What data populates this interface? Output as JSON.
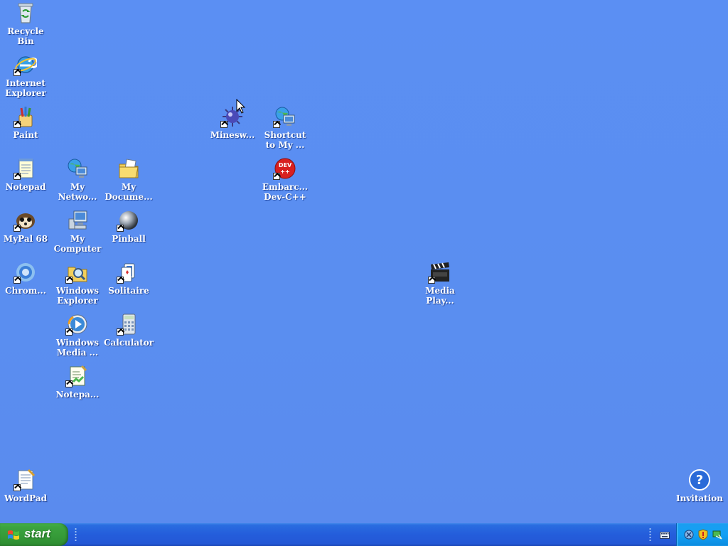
{
  "desktop": {
    "icons": [
      {
        "id": "recycle-bin",
        "label": "Recycle\nBin",
        "shortcut": false
      },
      {
        "id": "internet-explorer",
        "label": "Internet\nExplorer",
        "shortcut": true
      },
      {
        "id": "paint",
        "label": "Paint",
        "shortcut": true
      },
      {
        "id": "notepad",
        "label": "Notepad",
        "shortcut": true
      },
      {
        "id": "mypal",
        "label": "MyPal 68",
        "shortcut": true
      },
      {
        "id": "chrome",
        "label": "Chrom...",
        "shortcut": true
      },
      {
        "id": "my-network",
        "label": "My\nNetwo...",
        "shortcut": false
      },
      {
        "id": "my-computer",
        "label": "My\nComputer",
        "shortcut": false
      },
      {
        "id": "windows-explorer",
        "label": "Windows\nExplorer",
        "shortcut": true
      },
      {
        "id": "windows-media",
        "label": "Windows\nMedia ...",
        "shortcut": true
      },
      {
        "id": "notepad-plus",
        "label": "Notepa...",
        "shortcut": true
      },
      {
        "id": "my-documents",
        "label": "My\nDocume...",
        "shortcut": false
      },
      {
        "id": "pinball",
        "label": "Pinball",
        "shortcut": true
      },
      {
        "id": "solitaire",
        "label": "Solitaire",
        "shortcut": true
      },
      {
        "id": "calculator",
        "label": "Calculator",
        "shortcut": true
      },
      {
        "id": "minesweeper",
        "label": "Minesw...",
        "shortcut": true
      },
      {
        "id": "shortcut-my",
        "label": "Shortcut\nto My ...",
        "shortcut": true
      },
      {
        "id": "devcpp",
        "label": "Embarc...\nDev-C++",
        "shortcut": true
      },
      {
        "id": "media-player",
        "label": "Media\nPlay...",
        "shortcut": true
      },
      {
        "id": "wordpad",
        "label": "WordPad",
        "shortcut": true
      },
      {
        "id": "invitation",
        "label": "Invitation",
        "shortcut": false
      }
    ]
  },
  "taskbar": {
    "start_label": "start"
  },
  "colors": {
    "desktop_bg": "#5a8ff0",
    "taskbar_blue": "#245ddb",
    "start_green": "#359a38",
    "tray_blue": "#12a0f5"
  },
  "icon_names": {
    "recycle-bin": "recycle-bin-icon",
    "internet-explorer": "internet-explorer-icon",
    "paint": "paint-icon",
    "notepad": "notepad-icon",
    "mypal": "mypal-icon",
    "chrome": "chrome-icon",
    "my-network": "network-icon",
    "my-computer": "computer-icon",
    "windows-explorer": "explorer-icon",
    "windows-media": "media-player-icon",
    "notepad-plus": "notepad-plus-icon",
    "my-documents": "documents-folder-icon",
    "pinball": "pinball-icon",
    "solitaire": "solitaire-icon",
    "calculator": "calculator-icon",
    "minesweeper": "minesweeper-icon",
    "shortcut-my": "network-icon",
    "devcpp": "devcpp-icon",
    "media-player": "clapperboard-icon",
    "wordpad": "wordpad-icon",
    "invitation": "help-icon"
  }
}
